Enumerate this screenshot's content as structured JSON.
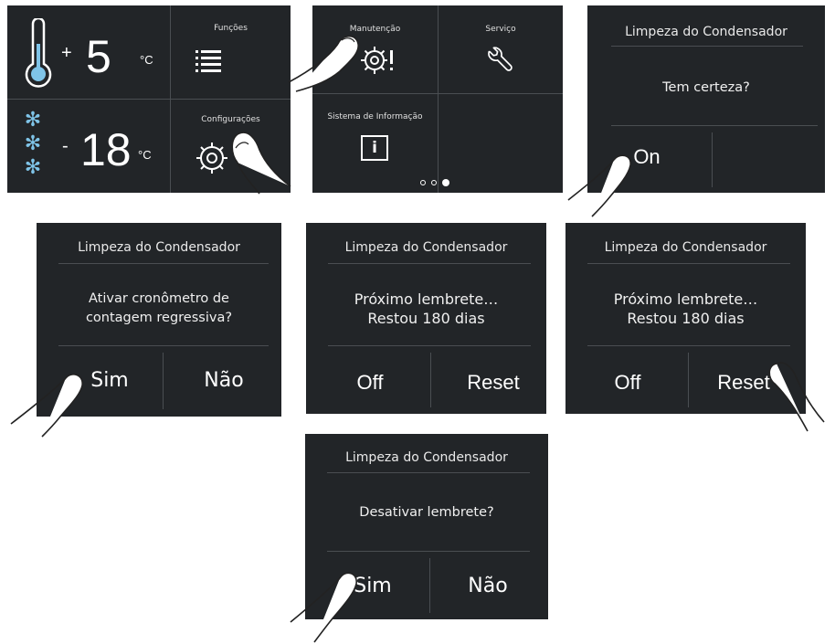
{
  "home": {
    "fridge_sign": "+",
    "fridge_temp": "5",
    "fridge_unit": "°C",
    "freezer_sign": "-",
    "freezer_temp": "18",
    "freezer_unit": "°C",
    "funcoes_label": "Funções",
    "config_label": "Configurações",
    "icons": [
      "thermometer-icon",
      "snowflake-icon",
      "list-icon",
      "gear-icon"
    ]
  },
  "menu": {
    "manutencao_label": "Manutenção",
    "servico_label": "Serviço",
    "sistema_label": "Sistema de Informação",
    "info_glyph": "i",
    "page_dots": 3,
    "active_dot": 3,
    "icons": [
      "gear-alert-icon",
      "wrench-icon",
      "info-icon"
    ]
  },
  "screen_confirm": {
    "title": "Limpeza do Condensador",
    "message": "Tem certeza?",
    "on_label": "On"
  },
  "screen_countdown": {
    "title": "Limpeza do Condensador",
    "message_line1": "Ativar cronômetro de",
    "message_line2": "contagem regressiva?",
    "yes_label": "Sim",
    "no_label": "Não"
  },
  "screen_reminder_a": {
    "title": "Limpeza do Condensador",
    "message_line1": "Próximo lembrete…",
    "message_line2": "Restou 180 dias",
    "off_label": "Off",
    "reset_label": "Reset"
  },
  "screen_reminder_b": {
    "title": "Limpeza do Condensador",
    "message_line1": "Próximo lembrete…",
    "message_line2": "Restou 180 dias",
    "off_label": "Off",
    "reset_label": "Reset"
  },
  "screen_disable": {
    "title": "Limpeza do Condensador",
    "message": "Desativar lembrete?",
    "yes_label": "Sim",
    "no_label": "Não"
  },
  "colors": {
    "panel_bg": "#222528",
    "divider": "#4a4e52",
    "snowflake": "#7fc4e8",
    "text": "#ffffff"
  }
}
